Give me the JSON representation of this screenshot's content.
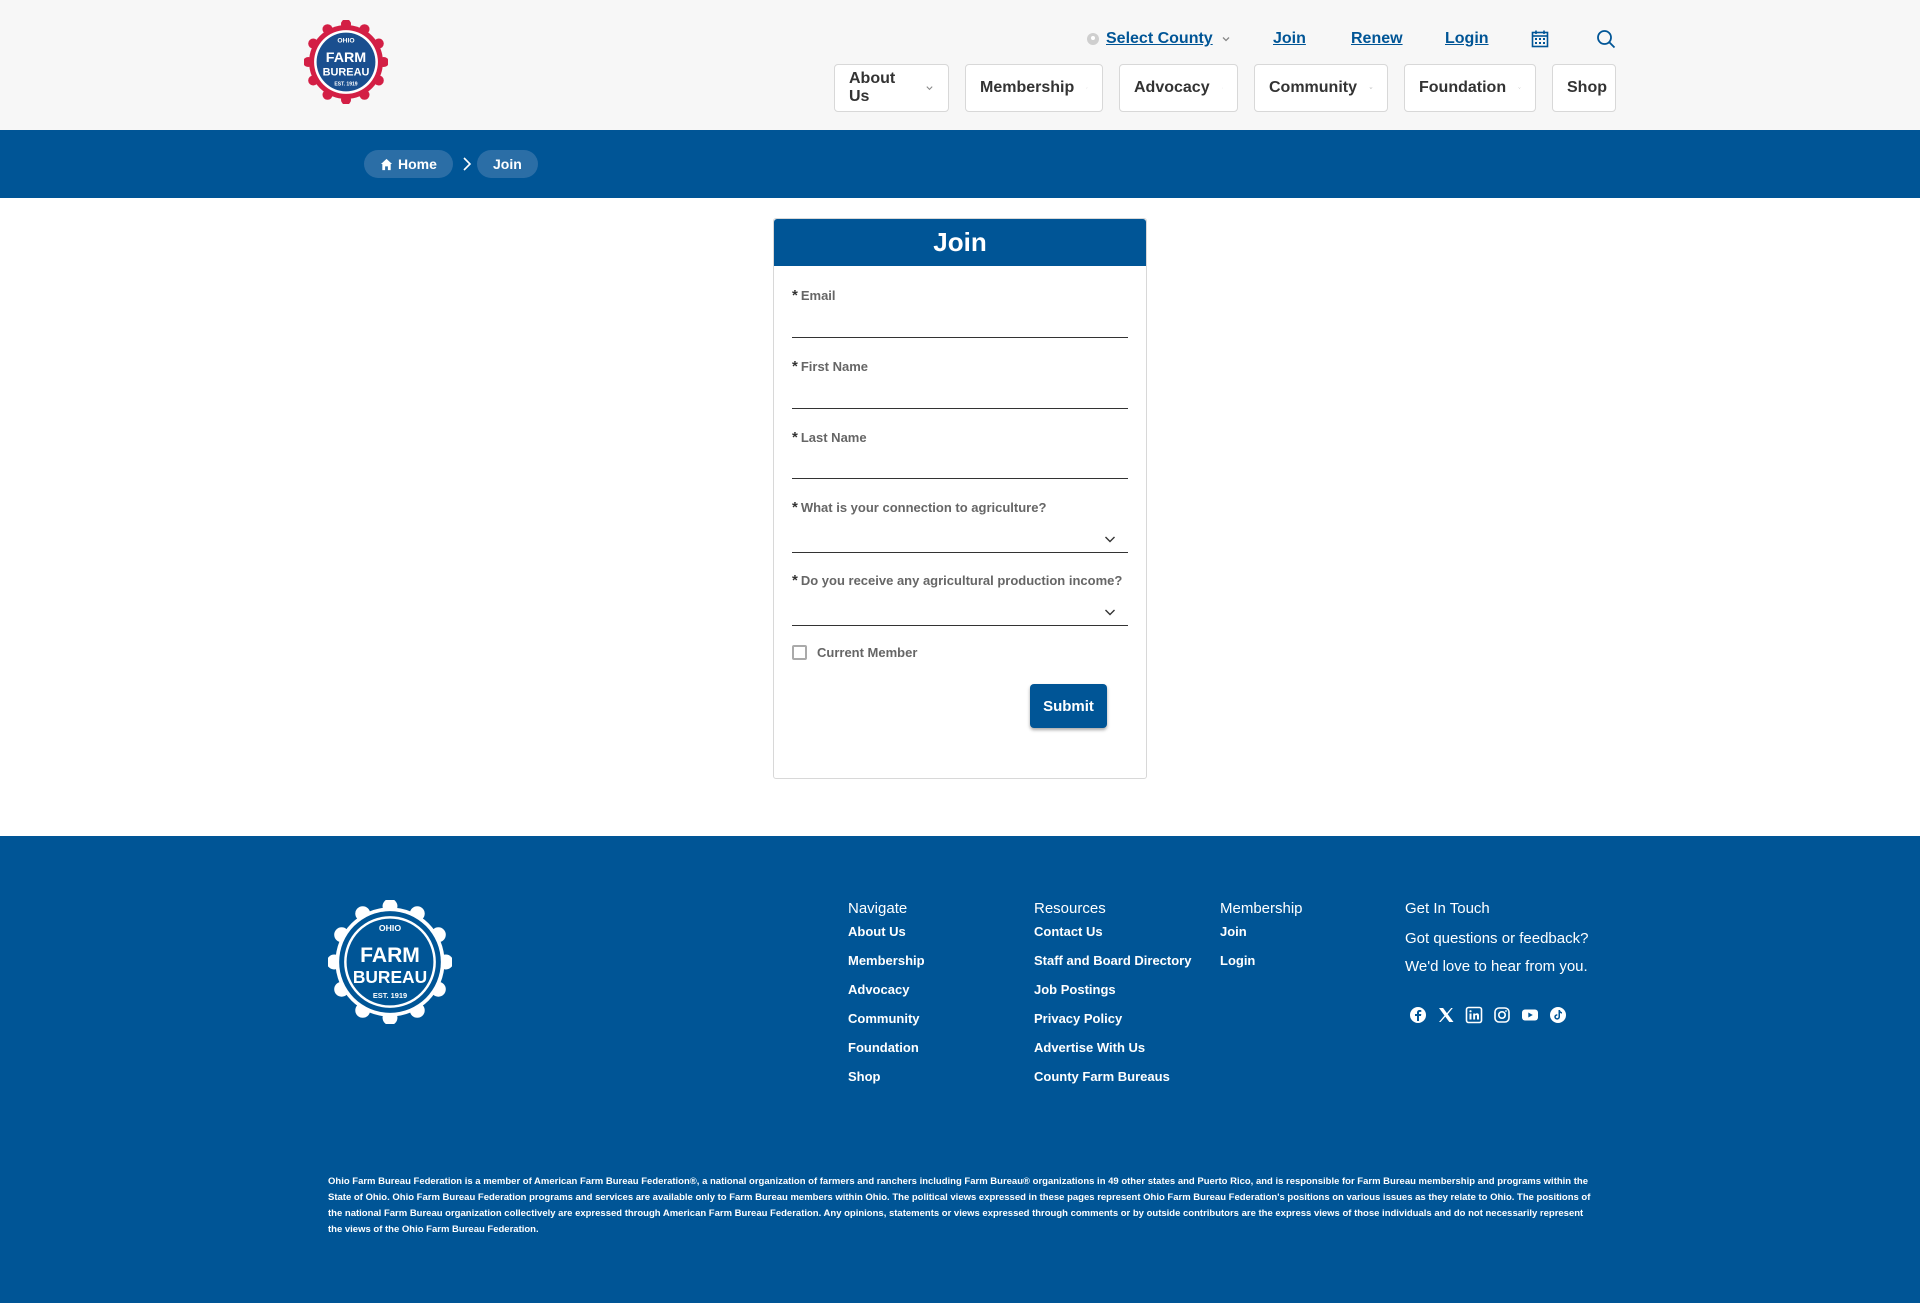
{
  "header": {
    "logo_text_top": "OHIO",
    "logo_text_main1": "FARM",
    "logo_text_main2": "BUREAU",
    "logo_text_est": "EST. 1919",
    "select_county": "Select County",
    "utility_join": "Join",
    "utility_renew": "Renew",
    "utility_login": "Login",
    "nav": [
      {
        "label": "About Us"
      },
      {
        "label": "Membership"
      },
      {
        "label": "Advocacy"
      },
      {
        "label": "Community"
      },
      {
        "label": "Foundation"
      },
      {
        "label": "Shop"
      }
    ]
  },
  "breadcrumb": {
    "home": "Home",
    "current": "Join"
  },
  "form": {
    "title": "Join",
    "fields": {
      "email": {
        "label": "Email",
        "value": ""
      },
      "first_name": {
        "label": "First Name",
        "value": ""
      },
      "last_name": {
        "label": "Last Name",
        "value": ""
      },
      "connection": {
        "label": "What is your connection to agriculture?",
        "value": ""
      },
      "income": {
        "label": "Do you receive any agricultural production income?",
        "value": ""
      }
    },
    "required_marker": "*",
    "current_member": "Current Member",
    "submit": "Submit"
  },
  "footer": {
    "navigate_title": "Navigate",
    "navigate": [
      "About Us",
      "Membership",
      "Advocacy",
      "Community",
      "Foundation",
      "Shop"
    ],
    "resources_title": "Resources",
    "resources": [
      "Contact Us",
      "Staff and Board Directory",
      "Job Postings",
      "Privacy Policy",
      "Advertise With Us",
      "County Farm Bureaus"
    ],
    "membership_title": "Membership",
    "membership": [
      "Join",
      "Login"
    ],
    "contact_title": "Get In Touch",
    "contact_line1": "Got questions or feedback?",
    "contact_line2": "We'd love to hear from you.",
    "socials": [
      "facebook-icon",
      "x-icon",
      "linkedin-icon",
      "instagram-icon",
      "youtube-icon",
      "tiktok-icon"
    ],
    "disclaimer": "Ohio Farm Bureau Federation is a member of American Farm Bureau Federation®, a national organization of farmers and ranchers including Farm Bureau® organizations in 49 other states and Puerto Rico, and is responsible for Farm Bureau membership and programs within the State of Ohio. Ohio Farm Bureau Federation programs and services are available only to Farm Bureau members within Ohio. The political views expressed in these pages represent Ohio Farm Bureau Federation's positions on various issues as they relate to Ohio. The positions of the national Farm Bureau organization collectively are expressed through American Farm Bureau Federation. Any opinions, statements or views expressed through comments or by outside contributors are the express views of those individuals and do not necessarily represent the views of the Ohio Farm Bureau Federation."
  },
  "colors": {
    "brand_blue": "#005596",
    "brand_red": "#d31f45",
    "header_bg": "#f7f7f7"
  }
}
